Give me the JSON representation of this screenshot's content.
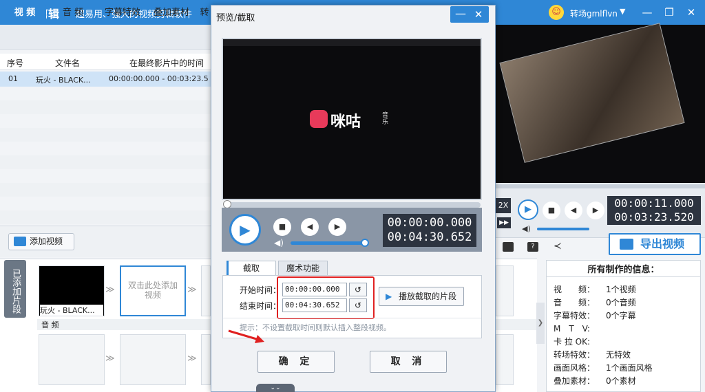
{
  "app": {
    "name": "爱剪辑",
    "slogan": "超易用、强大的视频剪辑软件",
    "username": "转场gmlflvn"
  },
  "tabs": [
    "视 频",
    "音 频",
    "字幕特效",
    "叠加素材",
    "转"
  ],
  "table": {
    "headers": [
      "序号",
      "文件名",
      "在最终影片中的时间"
    ],
    "rows": [
      {
        "no": "01",
        "name": "玩火 - BLACK...",
        "time": "00:00:00.000 - 00:03:23.5"
      }
    ]
  },
  "add_video_label": "添加视频",
  "timeline": {
    "added_segments_tab": "已添加片段",
    "clip_name": "玩火 - BLACK...",
    "add_hint": "双击此处添加视频",
    "audio_label": "音 频"
  },
  "dialog": {
    "title": "预览/截取",
    "video_brand": "咪咕",
    "video_brand_sub": "音乐",
    "time_current": "00:00:00.000",
    "time_total": "00:04:30.652",
    "tabs": [
      "截取",
      "魔术功能"
    ],
    "start_label": "开始时间：",
    "end_label": "结束时间：",
    "start_value": "00:00:00.000",
    "end_value": "00:04:30.652",
    "play_segment_label": "播放截取的片段",
    "hint": "提示：不设置截取时间则默认插入整段视频。",
    "ok_label": "确 定",
    "cancel_label": "取 消",
    "progress": 0.0,
    "volume": 0.95
  },
  "right": {
    "speed": "2X",
    "time_current": "00:00:11.000",
    "time_total": "00:03:23.520",
    "export_label": "导出视频",
    "info_title": "所有制作的信息：",
    "info": [
      {
        "k": "视　　频：",
        "v": "1个视频"
      },
      {
        "k": "音　　频：",
        "v": "0个音频"
      },
      {
        "k": "字幕特效：",
        "v": "0个字幕"
      },
      {
        "k": "M　T　V:",
        "v": ""
      },
      {
        "k": "卡 拉 OK:",
        "v": ""
      },
      {
        "k": "转场特效：",
        "v": "无特效"
      },
      {
        "k": "画面风格：",
        "v": "1个画面风格"
      },
      {
        "k": "叠加素材：",
        "v": "0个素材"
      }
    ]
  },
  "colors": {
    "accent": "#2f87d6",
    "highlight_box": "#e02020"
  }
}
